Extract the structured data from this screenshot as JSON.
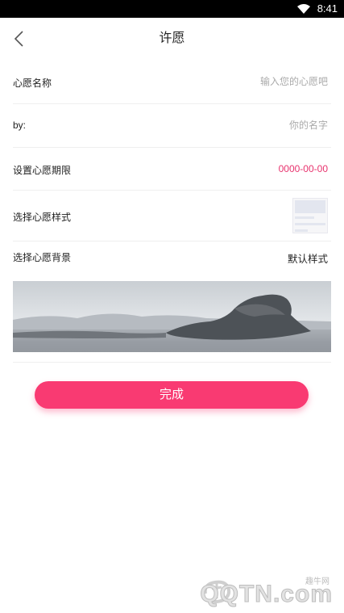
{
  "status_bar": {
    "time": "8:41",
    "icons": [
      "wifi-icon"
    ]
  },
  "header": {
    "title": "许愿",
    "back_icon": "chevron-left-icon"
  },
  "form": {
    "wish_name": {
      "label": "心愿名称",
      "placeholder": "输入您的心愿吧"
    },
    "by": {
      "label": "by:",
      "placeholder": "你的名字"
    },
    "deadline": {
      "label": "设置心愿期限",
      "value": "0000-00-00"
    },
    "style": {
      "label": "选择心愿样式"
    },
    "background": {
      "label": "选择心愿背景",
      "value": "默认样式"
    }
  },
  "submit": {
    "label": "完成"
  },
  "watermark": {
    "small": "趣牛网",
    "big": "QQTN.com"
  },
  "colors": {
    "accent": "#f93a72",
    "date_value": "#e8336e",
    "placeholder": "#aaaaaa",
    "divider": "#efefef"
  }
}
